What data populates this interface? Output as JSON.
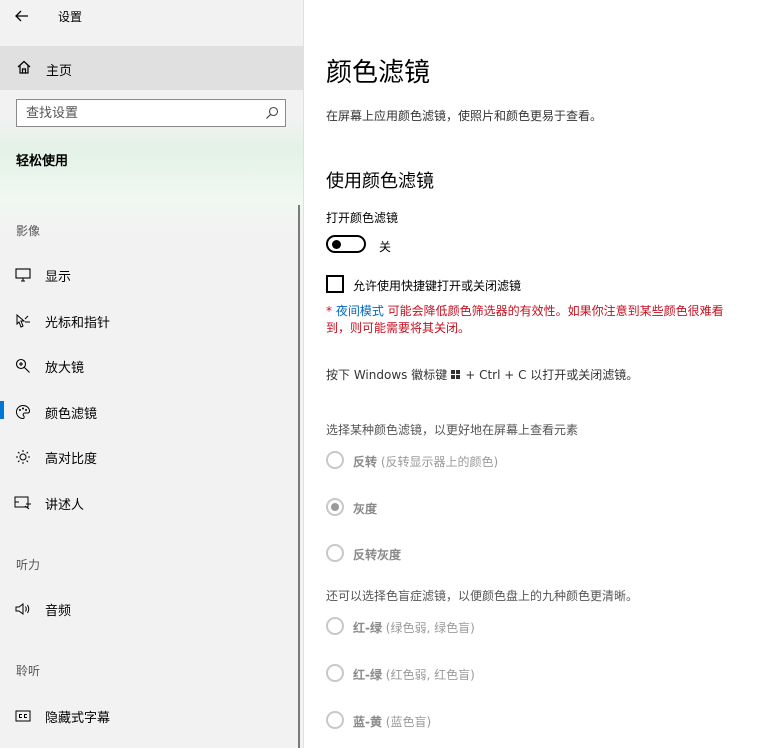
{
  "window": {
    "title": "设置"
  },
  "sidebar": {
    "home": "主页",
    "search_placeholder": "查找设置",
    "section_title": "轻松使用",
    "groups": {
      "vision": "影像",
      "hearing": "听力",
      "listening": "聆听"
    },
    "items": [
      {
        "label": "显示",
        "icon": "monitor-icon"
      },
      {
        "label": "光标和指针",
        "icon": "pointer-icon"
      },
      {
        "label": "放大镜",
        "icon": "magnifier-icon"
      },
      {
        "label": "颜色滤镜",
        "icon": "palette-icon",
        "active": true
      },
      {
        "label": "高对比度",
        "icon": "contrast-sun-icon"
      },
      {
        "label": "讲述人",
        "icon": "narrator-icon"
      },
      {
        "label": "音频",
        "icon": "speaker-icon"
      },
      {
        "label": "隐藏式字幕",
        "icon": "captions-icon"
      }
    ]
  },
  "main": {
    "title": "颜色滤镜",
    "description": "在屏幕上应用颜色滤镜，使照片和颜色更易于查看。",
    "subtitle": "使用颜色滤镜",
    "toggle_caption": "打开颜色滤镜",
    "toggle_state": "关",
    "checkbox_label": "允许使用快捷键打开或关闭滤镜",
    "warning_prefix": "* ",
    "warning_link": "夜间模式",
    "warning_text": " 可能会降低颜色筛选器的有效性。如果你注意到某些颜色很难看到，则可能需要将其关闭。",
    "hint_before": "按下 Windows 徽标键",
    "hint_after": "+ Ctrl + C 以打开或关闭滤镜。",
    "choose_filter": "选择某种颜色滤镜，以更好地在屏幕上查看元素",
    "filters": [
      {
        "label": "反转",
        "detail": " (反转显示器上的颜色)",
        "checked": false
      },
      {
        "label": "灰度",
        "detail": "",
        "checked": true
      },
      {
        "label": "反转灰度",
        "detail": "",
        "checked": false
      }
    ],
    "choose_colorblind": "还可以选择色盲症滤镜，以便颜色盘上的九种颜色更清晰。",
    "colorblind_filters": [
      {
        "label": "红-绿",
        "detail": " (绿色弱, 绿色盲)"
      },
      {
        "label": "红-绿",
        "detail": " (红色弱, 红色盲)"
      },
      {
        "label": "蓝-黄",
        "detail": " (蓝色盲)"
      }
    ]
  },
  "colors": {
    "accent": "#0078d4",
    "warning": "#c50f1f",
    "link": "#0067c0"
  }
}
